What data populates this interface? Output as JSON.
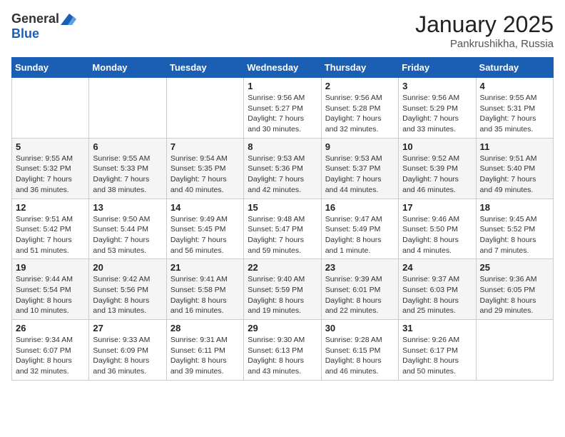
{
  "logo": {
    "general": "General",
    "blue": "Blue"
  },
  "title": {
    "month": "January 2025",
    "location": "Pankrushikha, Russia"
  },
  "weekdays": [
    "Sunday",
    "Monday",
    "Tuesday",
    "Wednesday",
    "Thursday",
    "Friday",
    "Saturday"
  ],
  "weeks": [
    [
      {
        "day": "",
        "content": ""
      },
      {
        "day": "",
        "content": ""
      },
      {
        "day": "",
        "content": ""
      },
      {
        "day": "1",
        "content": "Sunrise: 9:56 AM\nSunset: 5:27 PM\nDaylight: 7 hours\nand 30 minutes."
      },
      {
        "day": "2",
        "content": "Sunrise: 9:56 AM\nSunset: 5:28 PM\nDaylight: 7 hours\nand 32 minutes."
      },
      {
        "day": "3",
        "content": "Sunrise: 9:56 AM\nSunset: 5:29 PM\nDaylight: 7 hours\nand 33 minutes."
      },
      {
        "day": "4",
        "content": "Sunrise: 9:55 AM\nSunset: 5:31 PM\nDaylight: 7 hours\nand 35 minutes."
      }
    ],
    [
      {
        "day": "5",
        "content": "Sunrise: 9:55 AM\nSunset: 5:32 PM\nDaylight: 7 hours\nand 36 minutes."
      },
      {
        "day": "6",
        "content": "Sunrise: 9:55 AM\nSunset: 5:33 PM\nDaylight: 7 hours\nand 38 minutes."
      },
      {
        "day": "7",
        "content": "Sunrise: 9:54 AM\nSunset: 5:35 PM\nDaylight: 7 hours\nand 40 minutes."
      },
      {
        "day": "8",
        "content": "Sunrise: 9:53 AM\nSunset: 5:36 PM\nDaylight: 7 hours\nand 42 minutes."
      },
      {
        "day": "9",
        "content": "Sunrise: 9:53 AM\nSunset: 5:37 PM\nDaylight: 7 hours\nand 44 minutes."
      },
      {
        "day": "10",
        "content": "Sunrise: 9:52 AM\nSunset: 5:39 PM\nDaylight: 7 hours\nand 46 minutes."
      },
      {
        "day": "11",
        "content": "Sunrise: 9:51 AM\nSunset: 5:40 PM\nDaylight: 7 hours\nand 49 minutes."
      }
    ],
    [
      {
        "day": "12",
        "content": "Sunrise: 9:51 AM\nSunset: 5:42 PM\nDaylight: 7 hours\nand 51 minutes."
      },
      {
        "day": "13",
        "content": "Sunrise: 9:50 AM\nSunset: 5:44 PM\nDaylight: 7 hours\nand 53 minutes."
      },
      {
        "day": "14",
        "content": "Sunrise: 9:49 AM\nSunset: 5:45 PM\nDaylight: 7 hours\nand 56 minutes."
      },
      {
        "day": "15",
        "content": "Sunrise: 9:48 AM\nSunset: 5:47 PM\nDaylight: 7 hours\nand 59 minutes."
      },
      {
        "day": "16",
        "content": "Sunrise: 9:47 AM\nSunset: 5:49 PM\nDaylight: 8 hours\nand 1 minute."
      },
      {
        "day": "17",
        "content": "Sunrise: 9:46 AM\nSunset: 5:50 PM\nDaylight: 8 hours\nand 4 minutes."
      },
      {
        "day": "18",
        "content": "Sunrise: 9:45 AM\nSunset: 5:52 PM\nDaylight: 8 hours\nand 7 minutes."
      }
    ],
    [
      {
        "day": "19",
        "content": "Sunrise: 9:44 AM\nSunset: 5:54 PM\nDaylight: 8 hours\nand 10 minutes."
      },
      {
        "day": "20",
        "content": "Sunrise: 9:42 AM\nSunset: 5:56 PM\nDaylight: 8 hours\nand 13 minutes."
      },
      {
        "day": "21",
        "content": "Sunrise: 9:41 AM\nSunset: 5:58 PM\nDaylight: 8 hours\nand 16 minutes."
      },
      {
        "day": "22",
        "content": "Sunrise: 9:40 AM\nSunset: 5:59 PM\nDaylight: 8 hours\nand 19 minutes."
      },
      {
        "day": "23",
        "content": "Sunrise: 9:39 AM\nSunset: 6:01 PM\nDaylight: 8 hours\nand 22 minutes."
      },
      {
        "day": "24",
        "content": "Sunrise: 9:37 AM\nSunset: 6:03 PM\nDaylight: 8 hours\nand 25 minutes."
      },
      {
        "day": "25",
        "content": "Sunrise: 9:36 AM\nSunset: 6:05 PM\nDaylight: 8 hours\nand 29 minutes."
      }
    ],
    [
      {
        "day": "26",
        "content": "Sunrise: 9:34 AM\nSunset: 6:07 PM\nDaylight: 8 hours\nand 32 minutes."
      },
      {
        "day": "27",
        "content": "Sunrise: 9:33 AM\nSunset: 6:09 PM\nDaylight: 8 hours\nand 36 minutes."
      },
      {
        "day": "28",
        "content": "Sunrise: 9:31 AM\nSunset: 6:11 PM\nDaylight: 8 hours\nand 39 minutes."
      },
      {
        "day": "29",
        "content": "Sunrise: 9:30 AM\nSunset: 6:13 PM\nDaylight: 8 hours\nand 43 minutes."
      },
      {
        "day": "30",
        "content": "Sunrise: 9:28 AM\nSunset: 6:15 PM\nDaylight: 8 hours\nand 46 minutes."
      },
      {
        "day": "31",
        "content": "Sunrise: 9:26 AM\nSunset: 6:17 PM\nDaylight: 8 hours\nand 50 minutes."
      },
      {
        "day": "",
        "content": ""
      }
    ]
  ]
}
